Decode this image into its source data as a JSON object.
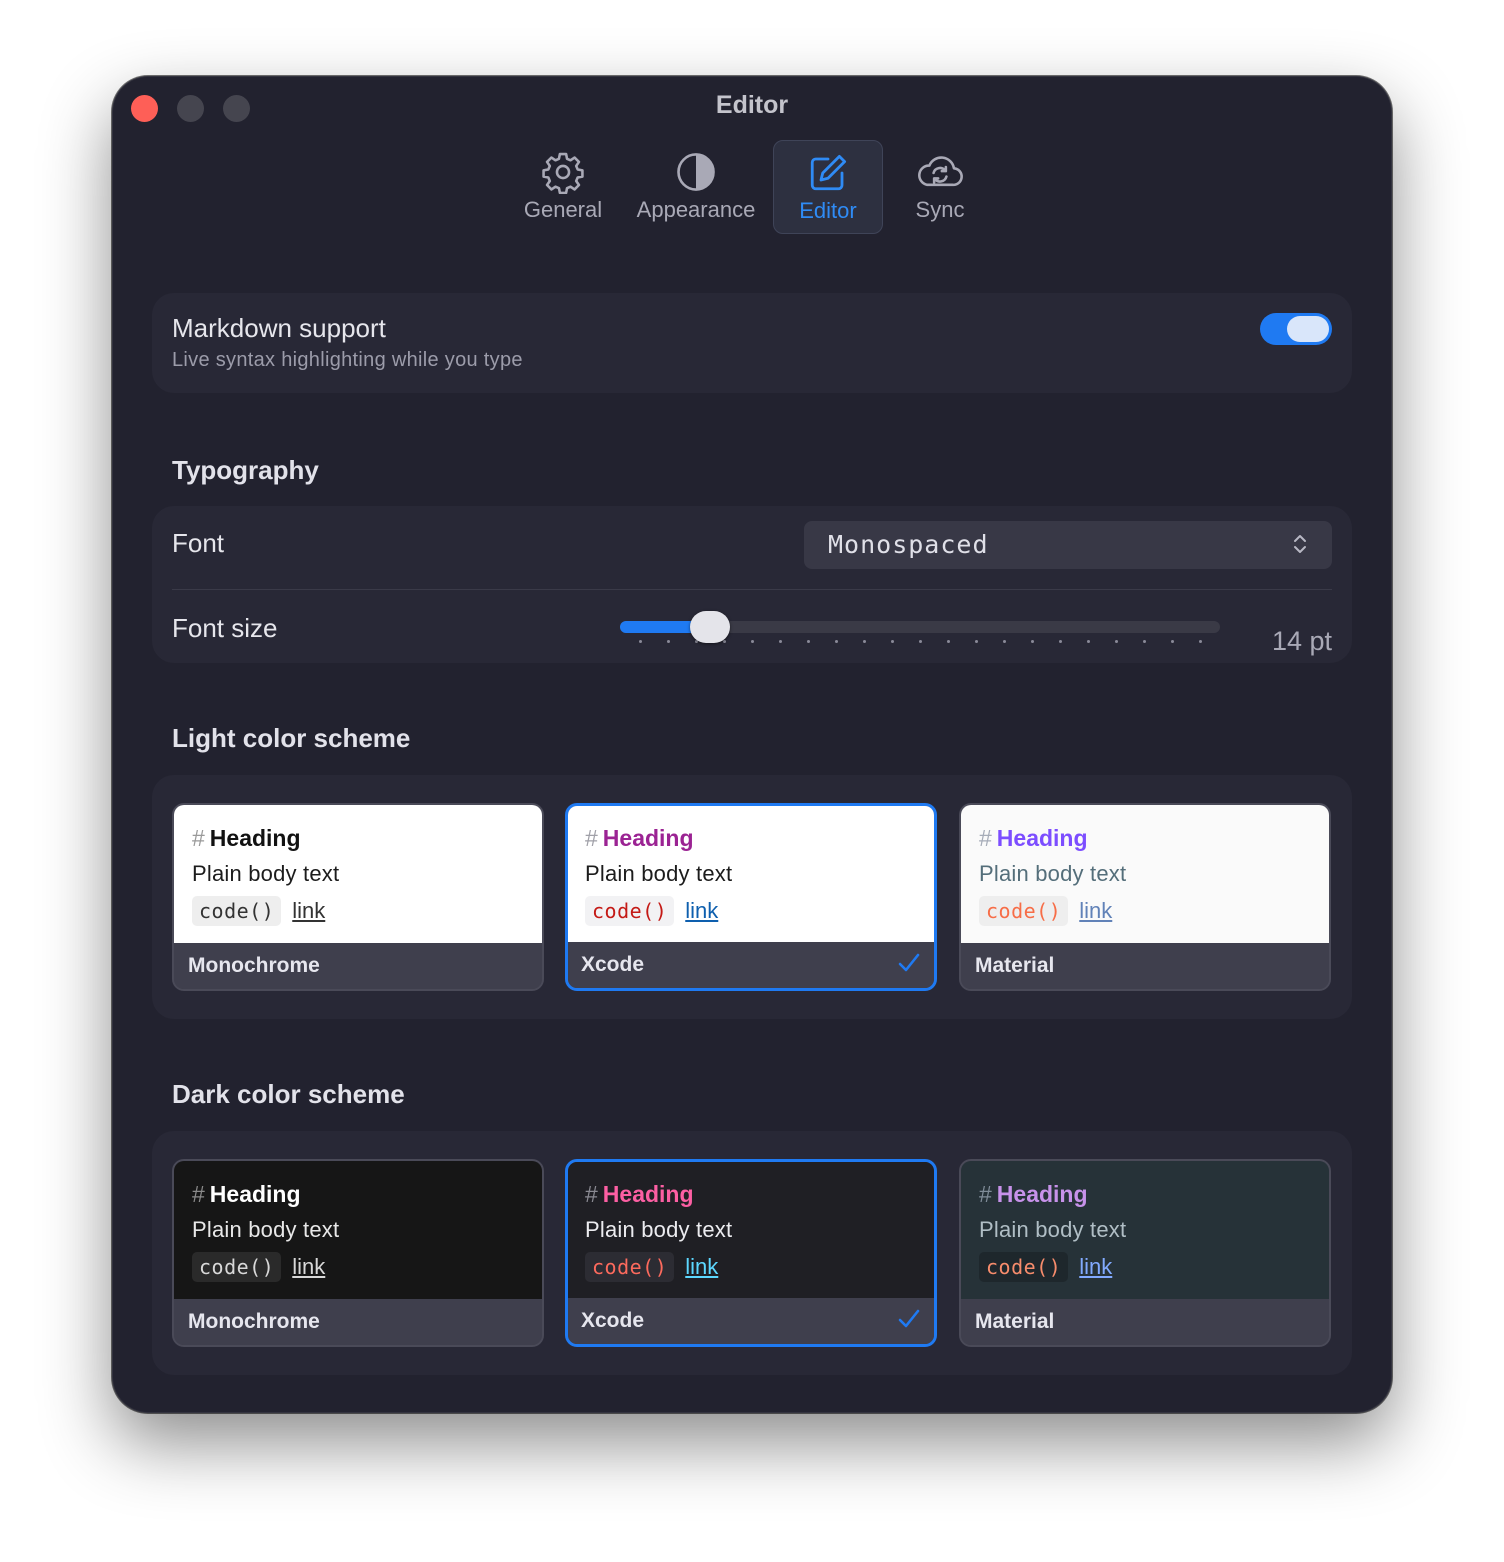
{
  "window": {
    "title": "Editor"
  },
  "tabs": [
    {
      "label": "General",
      "icon": "gear-icon"
    },
    {
      "label": "Appearance",
      "icon": "contrast-icon"
    },
    {
      "label": "Editor",
      "icon": "edit-icon",
      "active": true
    },
    {
      "label": "Sync",
      "icon": "cloud-sync-icon"
    }
  ],
  "markdown": {
    "title": "Markdown support",
    "subtitle": "Live syntax highlighting while you type",
    "enabled": true
  },
  "typography": {
    "section_title": "Typography",
    "font_label": "Font",
    "font_value": "Monospaced",
    "size_label": "Font size",
    "size_value": "14 pt",
    "size_fraction": 0.125
  },
  "preview_text": {
    "hash": "#",
    "heading": "Heading",
    "body": "Plain body text",
    "code": "code()",
    "link": "link"
  },
  "light_scheme": {
    "section_title": "Light color scheme",
    "options": [
      {
        "name": "Monochrome",
        "selected": false
      },
      {
        "name": "Xcode",
        "selected": true
      },
      {
        "name": "Material",
        "selected": false
      }
    ]
  },
  "dark_scheme": {
    "section_title": "Dark color scheme",
    "options": [
      {
        "name": "Monochrome",
        "selected": false
      },
      {
        "name": "Xcode",
        "selected": true
      },
      {
        "name": "Material",
        "selected": false
      }
    ]
  },
  "colors": {
    "accent": "#1f7af2",
    "window_bg": "#22222f",
    "card_bg": "#282836",
    "close_button": "#fe5f57"
  }
}
